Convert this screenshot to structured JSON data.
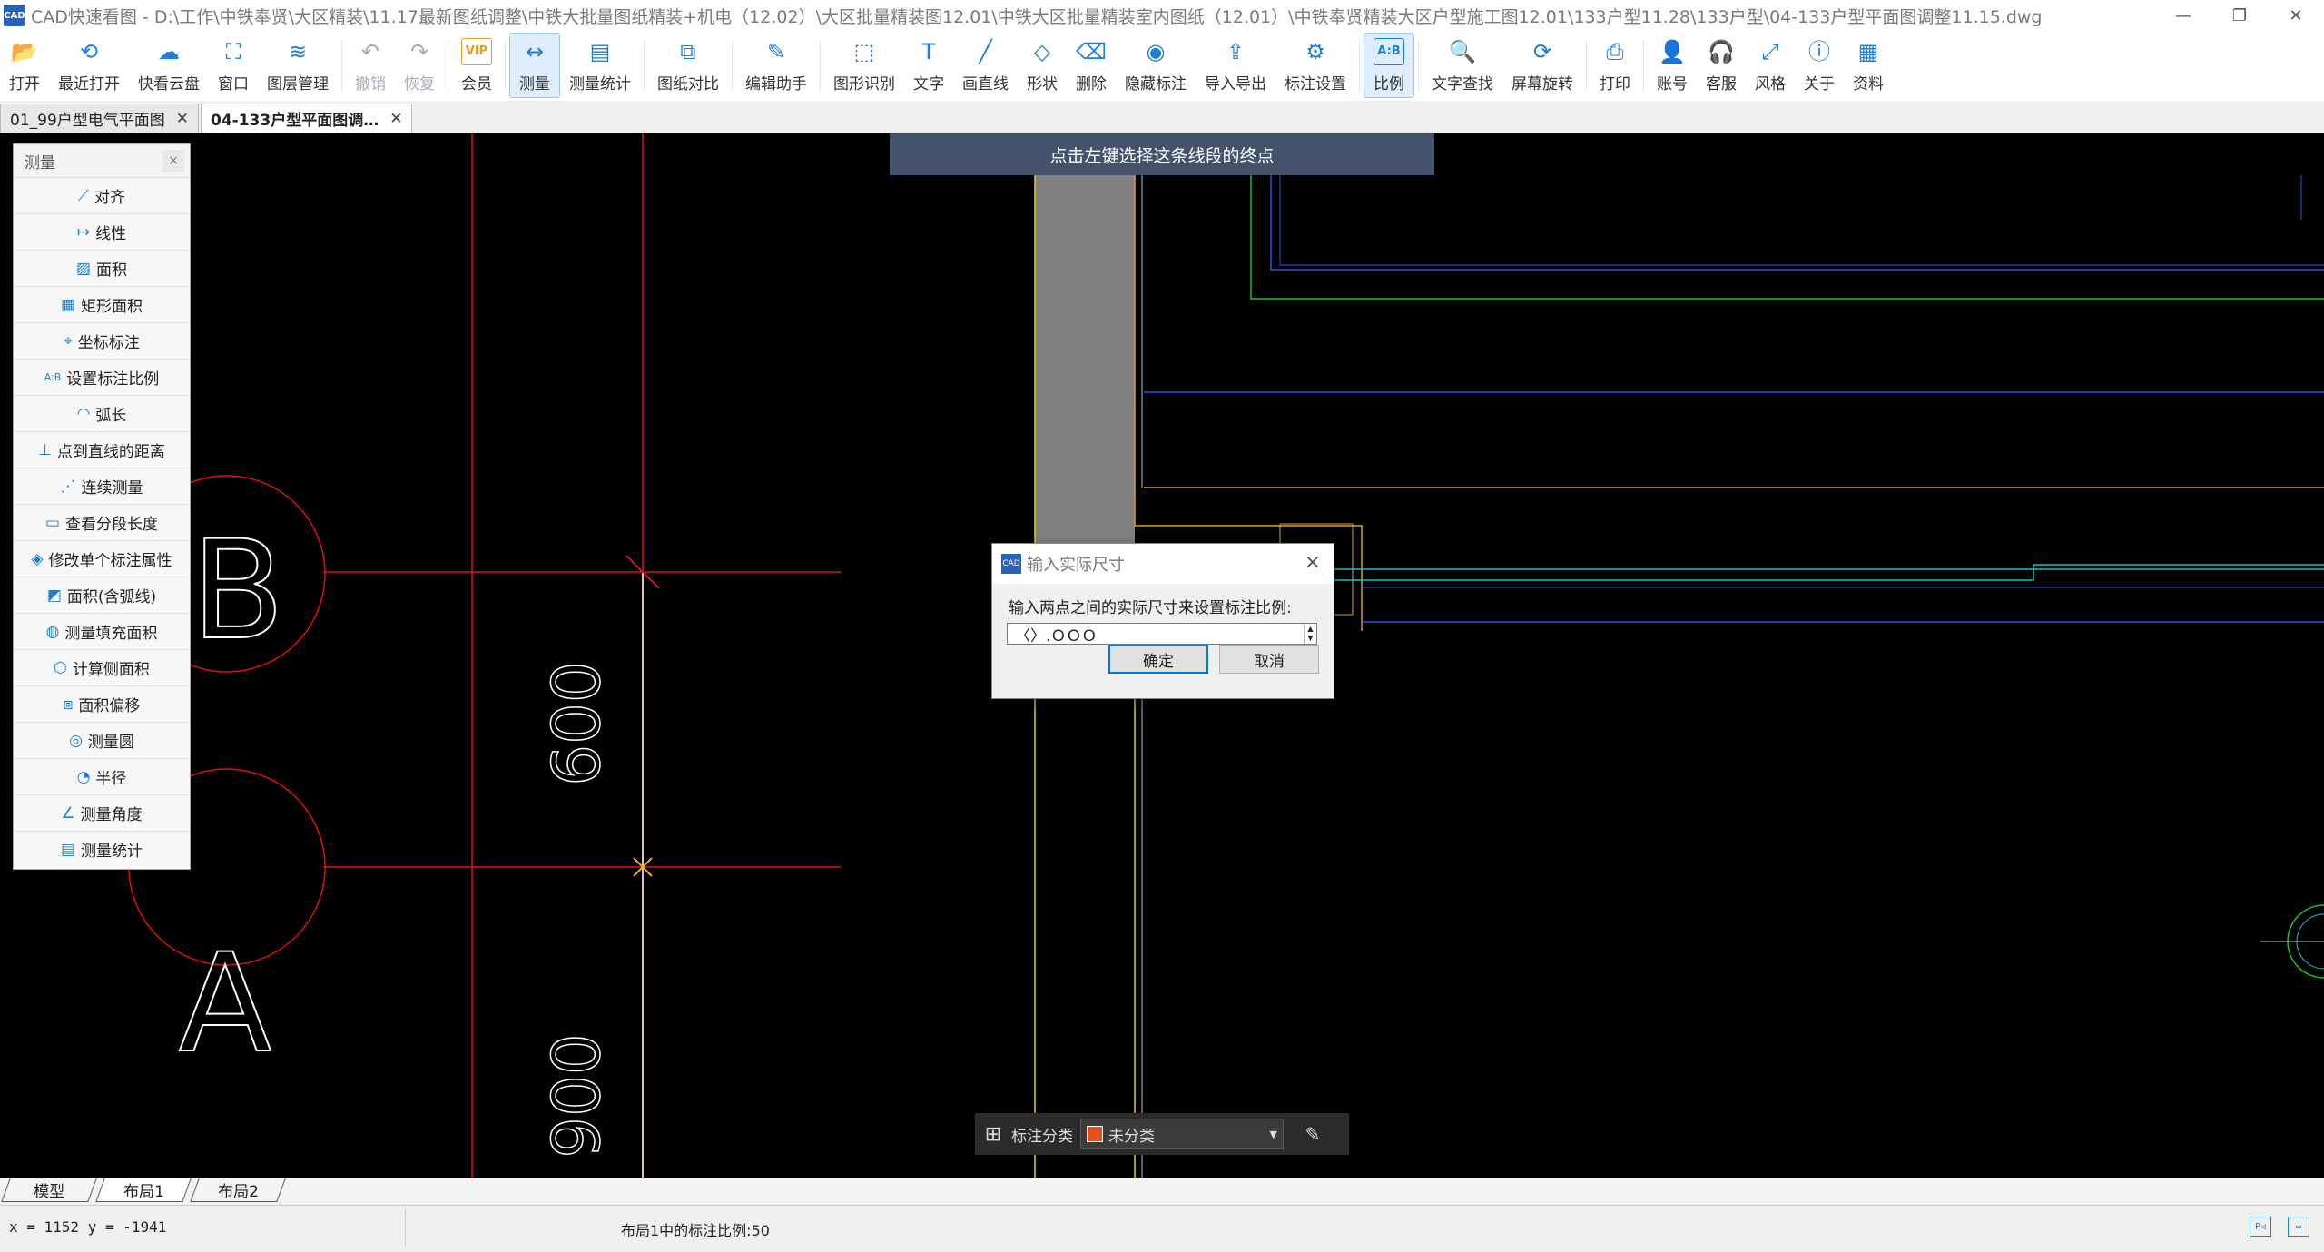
{
  "app": {
    "title": "CAD快速看图 - D:\\工作\\中铁奉贤\\大区精装\\11.17最新图纸调整\\中铁大批量图纸精装+机电（12.02）\\大区批量精装图12.01\\中铁大区批量精装室内图纸（12.01）\\中铁奉贤精装大区户型施工图12.01\\133户型11.28\\133户型\\04-133户型平面图调整11.15.dwg",
    "logo_text": "CAD"
  },
  "toolbar": [
    {
      "label": "打开",
      "icon": "folder-open-icon",
      "glyph": "📂",
      "state": "normal"
    },
    {
      "label": "最近打开",
      "icon": "recent-icon",
      "glyph": "⟲",
      "state": "normal"
    },
    {
      "label": "快看云盘",
      "icon": "cloud-icon",
      "glyph": "☁",
      "state": "normal"
    },
    {
      "label": "窗口",
      "icon": "window-icon",
      "glyph": "⛶",
      "state": "normal"
    },
    {
      "label": "图层管理",
      "icon": "layers-icon",
      "glyph": "≋",
      "state": "normal"
    },
    {
      "label": "撤销",
      "icon": "undo-icon",
      "glyph": "↶",
      "state": "disabled"
    },
    {
      "label": "恢复",
      "icon": "redo-icon",
      "glyph": "↷",
      "state": "disabled"
    },
    {
      "label": "会员",
      "icon": "vip-icon",
      "glyph": "VIP",
      "state": "vip"
    },
    {
      "label": "测量",
      "icon": "measure-icon",
      "glyph": "↔",
      "state": "active"
    },
    {
      "label": "测量统计",
      "icon": "measure-stats-icon",
      "glyph": "▤",
      "state": "normal"
    },
    {
      "label": "图纸对比",
      "icon": "compare-icon",
      "glyph": "⧉",
      "state": "normal"
    },
    {
      "label": "编辑助手",
      "icon": "edit-assistant-icon",
      "glyph": "✎",
      "state": "normal"
    },
    {
      "label": "图形识别",
      "icon": "shape-recognition-icon",
      "glyph": "⬚",
      "state": "normal"
    },
    {
      "label": "文字",
      "icon": "text-icon",
      "glyph": "T",
      "state": "normal"
    },
    {
      "label": "画直线",
      "icon": "line-icon",
      "glyph": "╱",
      "state": "normal"
    },
    {
      "label": "形状",
      "icon": "shape-icon",
      "glyph": "◇",
      "state": "normal"
    },
    {
      "label": "删除",
      "icon": "eraser-icon",
      "glyph": "⌫",
      "state": "normal"
    },
    {
      "label": "隐藏标注",
      "icon": "hide-annotation-icon",
      "glyph": "◉",
      "state": "normal"
    },
    {
      "label": "导入导出",
      "icon": "import-export-icon",
      "glyph": "⇪",
      "state": "normal"
    },
    {
      "label": "标注设置",
      "icon": "annotation-settings-icon",
      "glyph": "⚙",
      "state": "normal"
    },
    {
      "label": "比例",
      "icon": "scale-icon",
      "glyph": "A:B",
      "state": "active"
    },
    {
      "label": "文字查找",
      "icon": "text-search-icon",
      "glyph": "🔍",
      "state": "normal"
    },
    {
      "label": "屏幕旋转",
      "icon": "rotate-screen-icon",
      "glyph": "⟳",
      "state": "normal"
    },
    {
      "label": "打印",
      "icon": "print-icon",
      "glyph": "⎙",
      "state": "normal"
    },
    {
      "label": "账号",
      "icon": "account-icon",
      "glyph": "👤",
      "state": "normal"
    },
    {
      "label": "客服",
      "icon": "headset-icon",
      "glyph": "🎧",
      "state": "normal"
    },
    {
      "label": "风格",
      "icon": "style-icon",
      "glyph": "⤢",
      "state": "normal"
    },
    {
      "label": "关于",
      "icon": "info-icon",
      "glyph": "ⓘ",
      "state": "normal"
    },
    {
      "label": "资料",
      "icon": "resources-icon",
      "glyph": "▦",
      "state": "normal"
    }
  ],
  "tabs": [
    {
      "label": "01_99户型电气平面图",
      "active": false
    },
    {
      "label": "04-133户型平面图调…",
      "active": true
    }
  ],
  "measure_panel": {
    "title": "测量",
    "items": [
      {
        "label": "对齐",
        "glyph": "⟋"
      },
      {
        "label": "线性",
        "glyph": "↦"
      },
      {
        "label": "面积",
        "glyph": "▨"
      },
      {
        "label": "矩形面积",
        "glyph": "▦"
      },
      {
        "label": "坐标标注",
        "glyph": "⌖"
      },
      {
        "label": "设置标注比例",
        "glyph": "A:B"
      },
      {
        "label": "弧长",
        "glyph": "◠"
      },
      {
        "label": "点到直线的距离",
        "glyph": "⊥"
      },
      {
        "label": "连续测量",
        "glyph": "⋰"
      },
      {
        "label": "查看分段长度",
        "glyph": "▭"
      },
      {
        "label": "修改单个标注属性",
        "glyph": "◈"
      },
      {
        "label": "面积(含弧线)",
        "glyph": "◩"
      },
      {
        "label": "测量填充面积",
        "glyph": "◍"
      },
      {
        "label": "计算侧面积",
        "glyph": "⬡"
      },
      {
        "label": "面积偏移",
        "glyph": "⧈"
      },
      {
        "label": "测量圆",
        "glyph": "◎"
      },
      {
        "label": "半径",
        "glyph": "◔"
      },
      {
        "label": "测量角度",
        "glyph": "∠"
      },
      {
        "label": "测量统计",
        "glyph": "▤"
      }
    ]
  },
  "hint": "点击左键选择这条线段的终点",
  "dialog": {
    "title": "输入实际尺寸",
    "message": "输入两点之间的实际尺寸来设置标注比例:",
    "value": "〈〉.ＯＯＯ",
    "ok_label": "确定",
    "cancel_label": "取消"
  },
  "drawing": {
    "grid_labels": [
      "B",
      "A"
    ],
    "dimensions": [
      "600",
      "900"
    ]
  },
  "annotation_bar": {
    "label": "标注分类",
    "selected": "未分类",
    "swatch_color": "#e6501f"
  },
  "layout_tabs": [
    {
      "label": "模型",
      "active": false
    },
    {
      "label": "布局1",
      "active": true
    },
    {
      "label": "布局2",
      "active": false
    }
  ],
  "status": {
    "coords": "x = 1152 y = -1941",
    "scale_text": "布局1中的标注比例:50"
  },
  "colors": {
    "canvas": "#000000",
    "accent": "#1d7fd6",
    "hint_bg": "#45526c"
  }
}
